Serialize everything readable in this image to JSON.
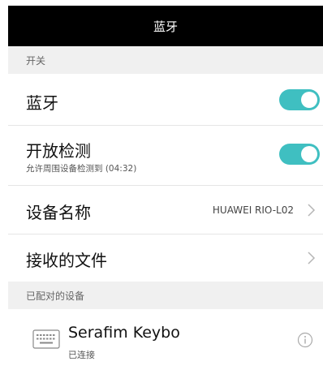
{
  "header": {
    "title": "蓝牙"
  },
  "sections": {
    "switch_header": "开关",
    "paired_header": "已配对的设备"
  },
  "bluetooth": {
    "label": "蓝牙",
    "enabled": true
  },
  "visibility": {
    "label": "开放检测",
    "subtitle": "允许周围设备检测到 (04:32)",
    "enabled": true
  },
  "device_name": {
    "label": "设备名称",
    "value": "HUAWEI RIO-L02"
  },
  "received_files": {
    "label": "接收的文件"
  },
  "paired_devices": [
    {
      "name": "Serafim Keybo",
      "status": "已连接",
      "icon": "keyboard-icon"
    }
  ],
  "colors": {
    "accent": "#3fbfc1",
    "titlebar": "#000000",
    "section_bg": "#f0f0f0"
  }
}
